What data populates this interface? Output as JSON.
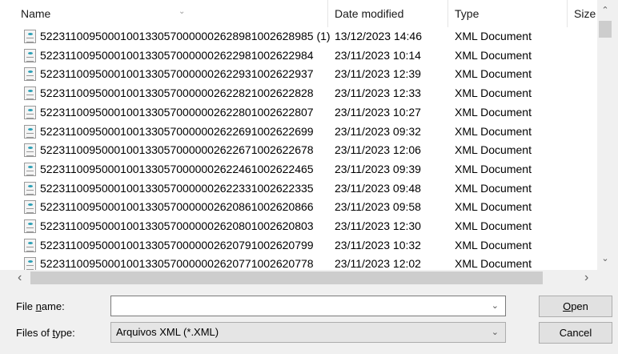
{
  "columns": {
    "name": "Name",
    "date": "Date modified",
    "type": "Type",
    "size": "Size"
  },
  "files": [
    {
      "name": "52231100950001001330570000002628981002628985 (1)",
      "date": "13/12/2023 14:46",
      "type": "XML Document"
    },
    {
      "name": "52231100950001001330570000002622981002622984",
      "date": "23/11/2023 10:14",
      "type": "XML Document"
    },
    {
      "name": "52231100950001001330570000002622931002622937",
      "date": "23/11/2023 12:39",
      "type": "XML Document"
    },
    {
      "name": "52231100950001001330570000002622821002622828",
      "date": "23/11/2023 12:33",
      "type": "XML Document"
    },
    {
      "name": "52231100950001001330570000002622801002622807",
      "date": "23/11/2023 10:27",
      "type": "XML Document"
    },
    {
      "name": "52231100950001001330570000002622691002622699",
      "date": "23/11/2023 09:32",
      "type": "XML Document"
    },
    {
      "name": "52231100950001001330570000002622671002622678",
      "date": "23/11/2023 12:06",
      "type": "XML Document"
    },
    {
      "name": "52231100950001001330570000002622461002622465",
      "date": "23/11/2023 09:39",
      "type": "XML Document"
    },
    {
      "name": "52231100950001001330570000002622331002622335",
      "date": "23/11/2023 09:48",
      "type": "XML Document"
    },
    {
      "name": "52231100950001001330570000002620861002620866",
      "date": "23/11/2023 09:58",
      "type": "XML Document"
    },
    {
      "name": "52231100950001001330570000002620801002620803",
      "date": "23/11/2023 12:30",
      "type": "XML Document"
    },
    {
      "name": "52231100950001001330570000002620791002620799",
      "date": "23/11/2023 10:32",
      "type": "XML Document"
    },
    {
      "name": "52231100950001001330570000002620771002620778",
      "date": "23/11/2023 12:02",
      "type": "XML Document"
    }
  ],
  "form": {
    "file_name_label_pre": "File ",
    "file_name_label_u": "n",
    "file_name_label_post": "ame:",
    "file_name_value": "",
    "type_label_pre": "Files of ",
    "type_label_u": "t",
    "type_label_post": "ype:",
    "type_value": "Arquivos XML (*.XML)",
    "open_u": "O",
    "open_rest": "pen",
    "cancel": "Cancel"
  }
}
